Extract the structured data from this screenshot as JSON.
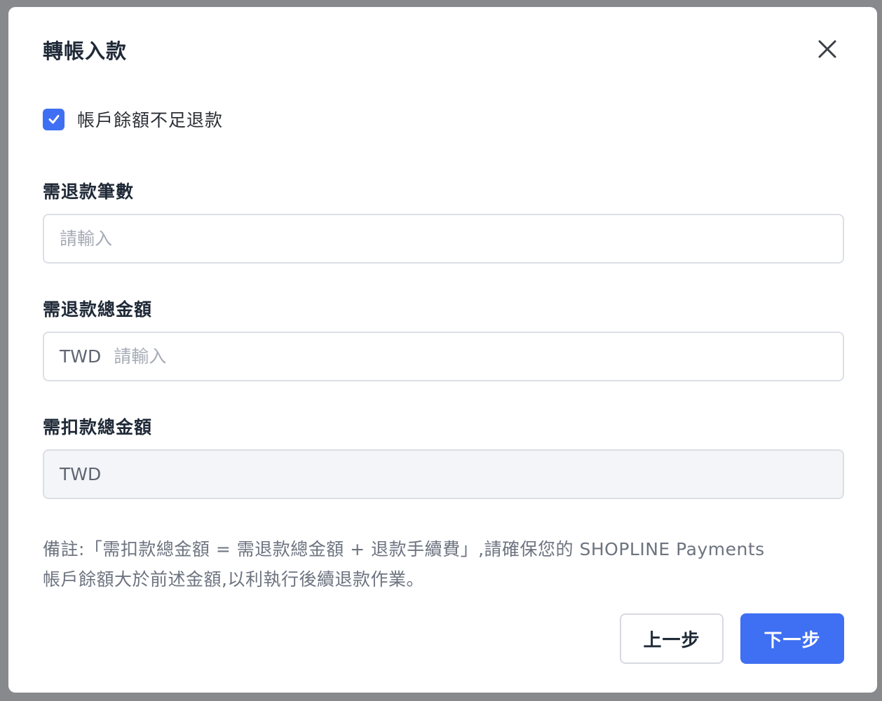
{
  "modal": {
    "title": "轉帳入款",
    "close_icon": "close-icon"
  },
  "checkbox": {
    "label": "帳戶餘額不足退款",
    "checked": true,
    "icon": "check-icon",
    "color": "#3f6ff2"
  },
  "fields": {
    "refund_count": {
      "label": "需退款筆數",
      "placeholder": "請輸入",
      "value": ""
    },
    "refund_total": {
      "label": "需退款總金額",
      "prefix": "TWD",
      "placeholder": "請輸入",
      "value": ""
    },
    "deduct_total": {
      "label": "需扣款總金額",
      "prefix": "TWD",
      "value": "",
      "disabled": true
    }
  },
  "note": {
    "line1": "備註:「需扣款總金額 = 需退款總金額 + 退款手續費」,請確保您的 SHOPLINE Payments",
    "line2": "帳戶餘額大於前述金額,以利執行後續退款作業。"
  },
  "buttons": {
    "back_label": "上一步",
    "next_label": "下一步",
    "primary_color": "#3f6ff2"
  }
}
